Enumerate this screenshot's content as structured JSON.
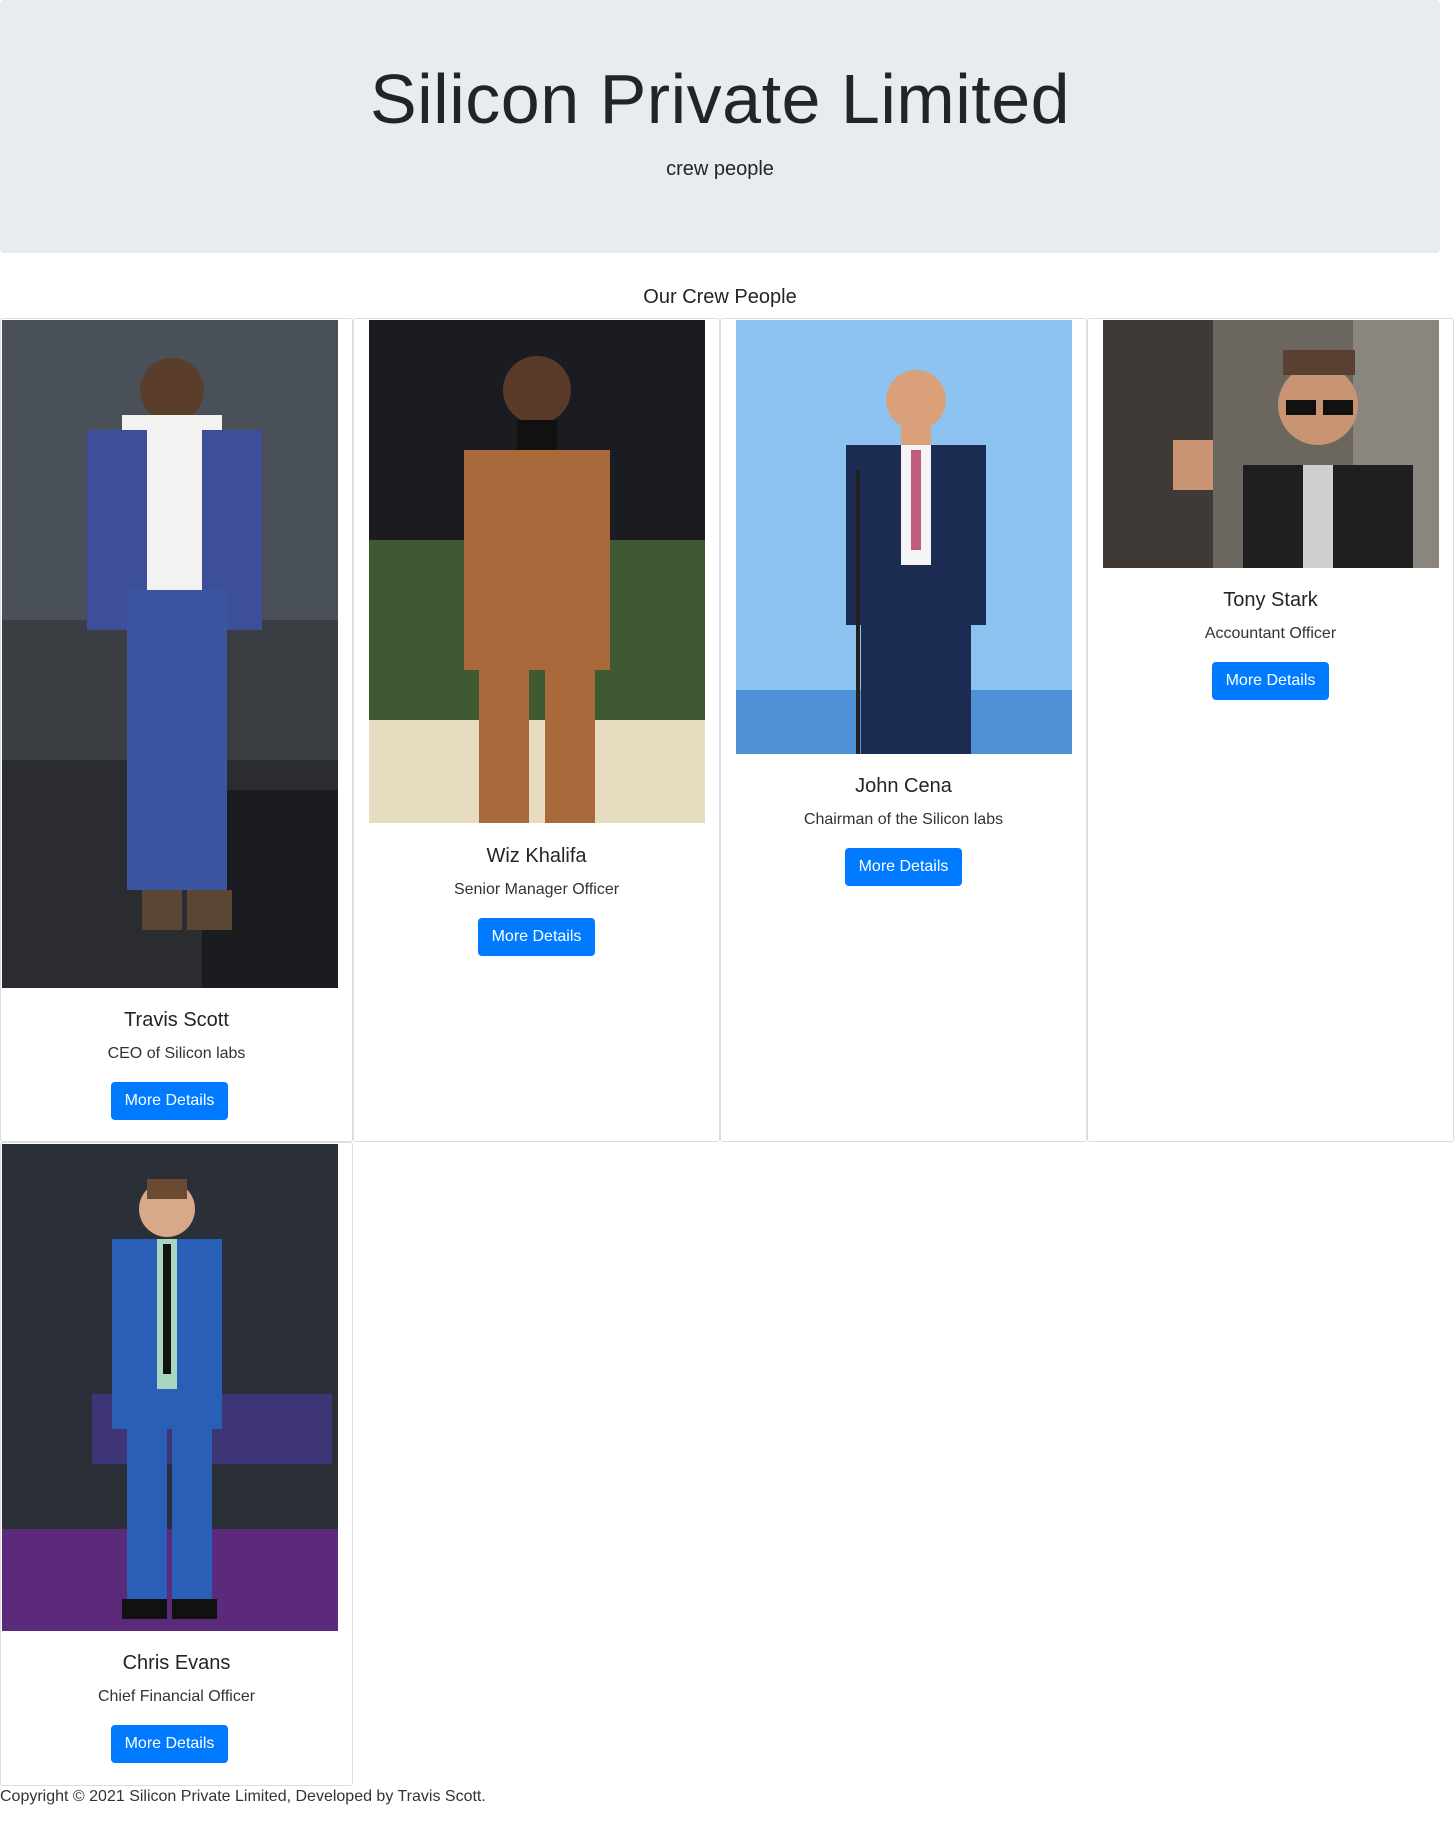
{
  "header": {
    "title": "Silicon Private Limited",
    "subtitle": "crew people"
  },
  "section": {
    "title": "Our Crew People"
  },
  "crew": [
    {
      "name": "Travis Scott",
      "role": "CEO of Silicon labs",
      "button": "More Details"
    },
    {
      "name": "Wiz Khalifa",
      "role": "Senior Manager Officer",
      "button": "More Details"
    },
    {
      "name": "John Cena",
      "role": "Chairman of the Silicon labs",
      "button": "More Details"
    },
    {
      "name": "Tony Stark",
      "role": "Accountant Officer",
      "button": "More Details"
    },
    {
      "name": "Chris Evans",
      "role": "Chief Financial Officer",
      "button": "More Details"
    }
  ],
  "footer": {
    "text": "Copyright © 2021 Silicon Private Limited, Developed by Travis Scott."
  },
  "colors": {
    "jumbotron_bg": "#e9ecef",
    "button_bg": "#007bff",
    "card_border": "#dcdcdc"
  }
}
